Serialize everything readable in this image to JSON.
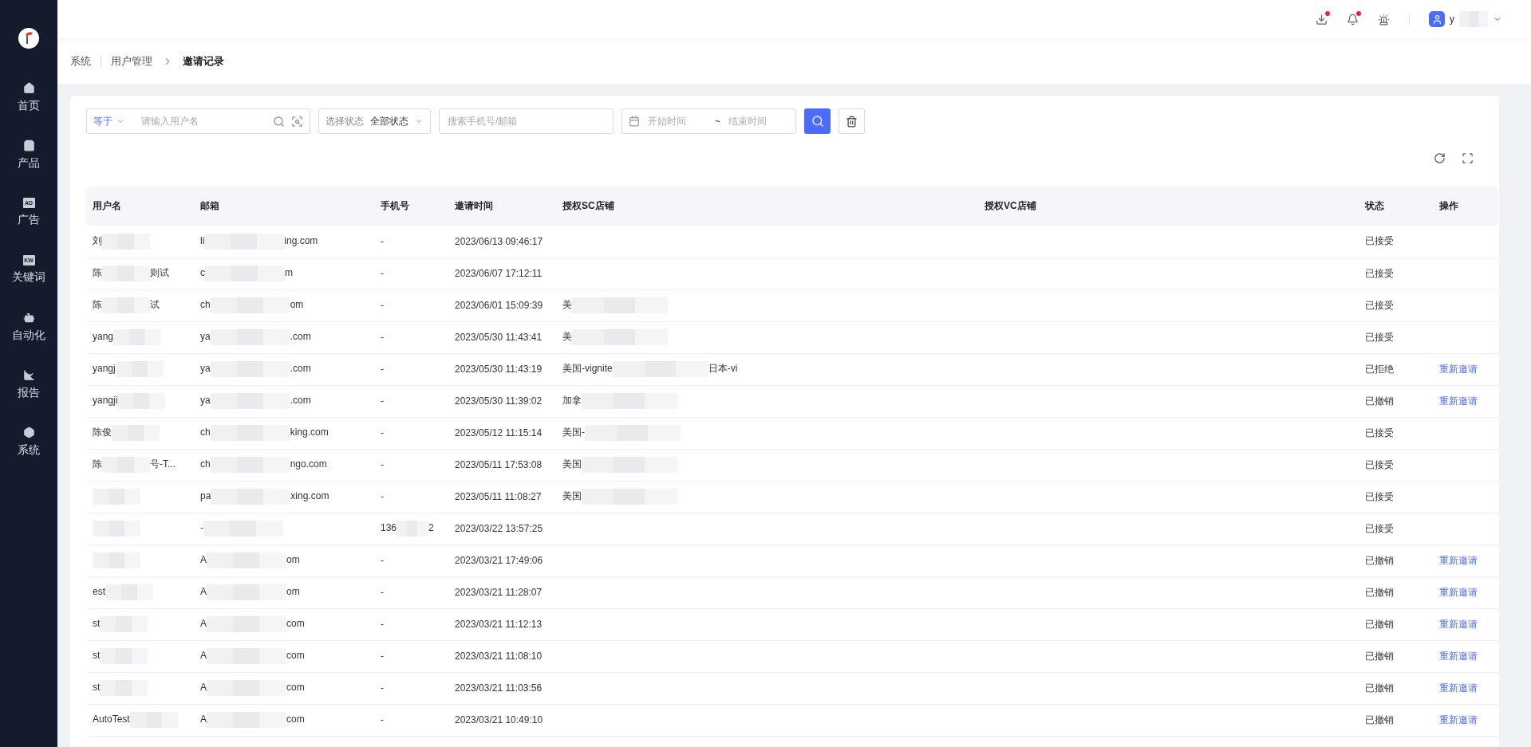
{
  "sidebar": {
    "items": [
      {
        "label": "首页",
        "selected": false
      },
      {
        "label": "产品",
        "selected": false
      },
      {
        "label": "广告",
        "selected": false,
        "icon_text": "AD"
      },
      {
        "label": "关键词",
        "selected": false,
        "icon_text": "KW"
      },
      {
        "label": "自动化",
        "selected": false
      },
      {
        "label": "报告",
        "selected": false
      },
      {
        "label": "系统",
        "selected": false
      }
    ]
  },
  "topbar": {
    "download_badge": true,
    "bell_badge": true,
    "user_name": "y"
  },
  "breadcrumb": [
    "系统",
    "用户管理",
    "邀请记录"
  ],
  "filters": {
    "match_mode": "等于",
    "username_placeholder": "请输入用户名",
    "status_label": "选择状态",
    "status_value": "全部状态",
    "contact_placeholder": "搜索手机号/邮箱",
    "start_placeholder": "开始时间",
    "range_separator": "~",
    "end_placeholder": "结束时间"
  },
  "table": {
    "columns": [
      "用户名",
      "邮箱",
      "手机号",
      "邀请时间",
      "授权SC店铺",
      "授权VC店铺",
      "状态",
      "操作"
    ],
    "rows": [
      {
        "username": [
          "刘"
        ],
        "email": [
          "li",
          "ing.com"
        ],
        "phone": [
          "-"
        ],
        "time": "2023/06/13 09:46:17",
        "sc": [],
        "status": "已接受"
      },
      {
        "username": [
          "陈",
          "则试"
        ],
        "email": [
          "c",
          "m"
        ],
        "phone": [
          "-"
        ],
        "time": "2023/06/07 17:12:11",
        "sc": [],
        "status": "已接受"
      },
      {
        "username": [
          "陈",
          "试"
        ],
        "email": [
          "ch",
          "om"
        ],
        "phone": [
          "-"
        ],
        "time": "2023/06/01 15:09:39",
        "sc": [
          "美"
        ],
        "status": "已接受"
      },
      {
        "username": [
          "yang"
        ],
        "email": [
          "ya",
          ".com"
        ],
        "phone": [
          "-"
        ],
        "time": "2023/05/30 11:43:41",
        "sc": [
          "美"
        ],
        "status": "已接受"
      },
      {
        "username": [
          "yangj"
        ],
        "email": [
          "ya",
          ".com"
        ],
        "phone": [
          "-"
        ],
        "time": "2023/05/30 11:43:19",
        "sc": [
          "美国-vignite",
          "日本-vi"
        ],
        "status": "已拒绝",
        "action": "重新邀请"
      },
      {
        "username": [
          "yangji"
        ],
        "email": [
          "ya",
          ".com"
        ],
        "phone": [
          "-"
        ],
        "time": "2023/05/30 11:39:02",
        "sc": [
          "加拿"
        ],
        "status": "已撤销",
        "action": "重新邀请"
      },
      {
        "username": [
          "陈俊"
        ],
        "email": [
          "ch",
          "king.com"
        ],
        "phone": [
          "-"
        ],
        "time": "2023/05/12 11:15:14",
        "sc": [
          "美国-"
        ],
        "status": "已接受"
      },
      {
        "username": [
          "陈",
          "号-T..."
        ],
        "email": [
          "ch",
          "ngo.com"
        ],
        "phone": [
          "-"
        ],
        "time": "2023/05/11 17:53:08",
        "sc": [
          "美国"
        ],
        "status": "已接受"
      },
      {
        "username": [],
        "email": [
          "pa",
          "xing.com"
        ],
        "phone": [
          "-"
        ],
        "time": "2023/05/11 11:08:27",
        "sc": [
          "美国"
        ],
        "status": "已接受"
      },
      {
        "username": [],
        "email": [
          "-"
        ],
        "phone": [
          "136",
          "2"
        ],
        "time": "2023/03/22 13:57:25",
        "sc": [],
        "status": "已接受"
      },
      {
        "username": [],
        "email": [
          "A",
          "om"
        ],
        "phone": [
          "-"
        ],
        "time": "2023/03/21 17:49:06",
        "sc": [],
        "status": "已撤销",
        "action": "重新邀请"
      },
      {
        "username": [
          "est"
        ],
        "email": [
          "A",
          "om"
        ],
        "phone": [
          "-"
        ],
        "time": "2023/03/21 11:28:07",
        "sc": [],
        "status": "已撤销",
        "action": "重新邀请"
      },
      {
        "username": [
          "st"
        ],
        "email": [
          "A",
          "com"
        ],
        "phone": [
          "-"
        ],
        "time": "2023/03/21 11:12:13",
        "sc": [],
        "status": "已撤销",
        "action": "重新邀请"
      },
      {
        "username": [
          "st"
        ],
        "email": [
          "A",
          "com"
        ],
        "phone": [
          "-"
        ],
        "time": "2023/03/21 11:08:10",
        "sc": [],
        "status": "已撤销",
        "action": "重新邀请"
      },
      {
        "username": [
          "st"
        ],
        "email": [
          "A",
          "com"
        ],
        "phone": [
          "-"
        ],
        "time": "2023/03/21 11:03:56",
        "sc": [],
        "status": "已撤销",
        "action": "重新邀请"
      },
      {
        "username": [
          "AutoTest"
        ],
        "email": [
          "A",
          "com"
        ],
        "phone": [
          "-"
        ],
        "time": "2023/03/21 10:49:10",
        "sc": [],
        "status": "已撤销",
        "action": "重新邀请"
      }
    ]
  }
}
